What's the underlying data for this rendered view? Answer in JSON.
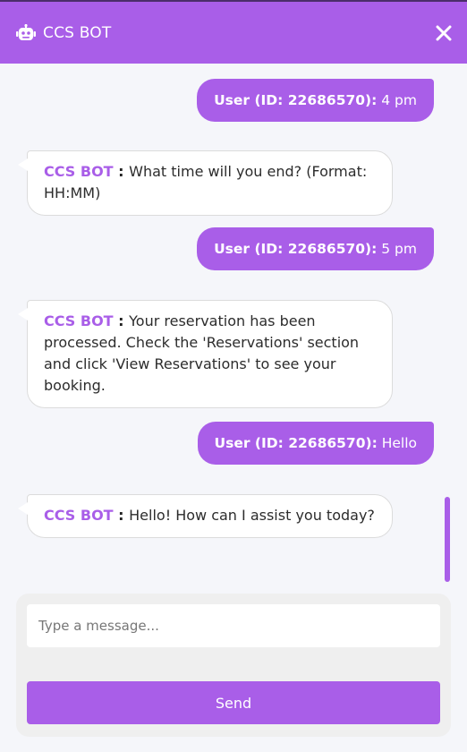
{
  "header": {
    "title": "CCS BOT",
    "bot_icon": "robot-icon",
    "close_icon": "close-icon"
  },
  "colors": {
    "accent": "#a95ee8",
    "background": "#f5f6fa",
    "bot_bubble": "#ffffff"
  },
  "messages": [
    {
      "role": "user",
      "sender": "User (ID: 22686570):",
      "text": " 4 pm"
    },
    {
      "role": "bot",
      "sender": "CCS BOT",
      "colon": " : ",
      "text": "What time will you end? (Format: HH:MM)"
    },
    {
      "role": "user",
      "sender": "User (ID: 22686570):",
      "text": " 5 pm"
    },
    {
      "role": "bot",
      "sender": "CCS BOT",
      "colon": " : ",
      "text": "Your reservation has been processed. Check the 'Reservations' section and click 'View Reservations' to see your booking."
    },
    {
      "role": "user",
      "sender": "User (ID: 22686570):",
      "text": " Hello"
    },
    {
      "role": "bot",
      "sender": "CCS BOT",
      "colon": " : ",
      "text": "Hello! How can I assist you today?"
    }
  ],
  "composer": {
    "placeholder": "Type a message...",
    "value": "",
    "send_label": "Send"
  }
}
